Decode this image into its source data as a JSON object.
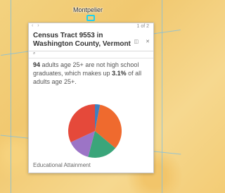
{
  "map": {
    "city_label": "Montpelier"
  },
  "popup": {
    "nav": {
      "prev_icon": "chevron-left-icon",
      "next_icon": "chevron-right-icon",
      "prev_label": "‹",
      "next_label": "›"
    },
    "pager": "1 of 2",
    "title": "Census Tract 9553 in Washington County, Vermont",
    "dock_icon": "dock-icon",
    "close_icon": "close-icon",
    "zoom_icon": "zoom-to-icon",
    "summary": {
      "count": "94",
      "text_a": " adults age 25+ are not high school graduates, which makes up ",
      "percent": "3.1%",
      "text_b": " of all adults age 25+."
    },
    "chart_caption": "Educational Attainment"
  },
  "chart_data": {
    "type": "pie",
    "title": "",
    "slices": [
      {
        "value": 3.1,
        "color": "#3f7fbf"
      },
      {
        "value": 33,
        "color": "#ef6a2e"
      },
      {
        "value": 18,
        "color": "#3aa57a"
      },
      {
        "value": 14,
        "color": "#9c74c6"
      },
      {
        "value": 31.9,
        "color": "#e5493a"
      }
    ]
  }
}
